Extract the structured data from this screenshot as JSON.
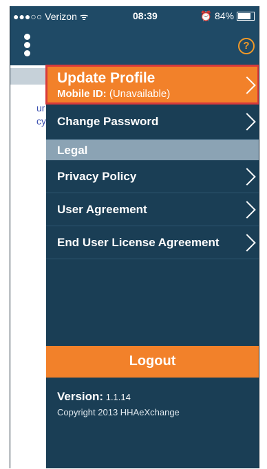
{
  "status": {
    "carrier": "●●●○○ Verizon ᯤ",
    "time": "08:39",
    "battery_text": "⏰ 84%",
    "battery_level": 0.84
  },
  "topbar": {
    "menu_icon": "kebab-menu-icon",
    "help_label": "?"
  },
  "left_fragments": [
    "ur",
    "cy"
  ],
  "menu": {
    "update_profile": {
      "title": "Update Profile",
      "mobile_id_label": "Mobile ID:",
      "mobile_id_value": "(Unavailable)"
    },
    "change_password": "Change Password",
    "legal_header": "Legal",
    "privacy_policy": "Privacy Policy",
    "user_agreement": "User Agreement",
    "eula": "End User License Agreement",
    "logout": "Logout",
    "version_label": "Version:",
    "version_value": "1.1.14",
    "copyright": "Copyright 2013 HHAeXchange"
  },
  "colors": {
    "accent": "#f2812a",
    "panel": "#1a3e55",
    "legal_band": "#8ba3b4",
    "highlight_outline": "#d83a3a"
  }
}
